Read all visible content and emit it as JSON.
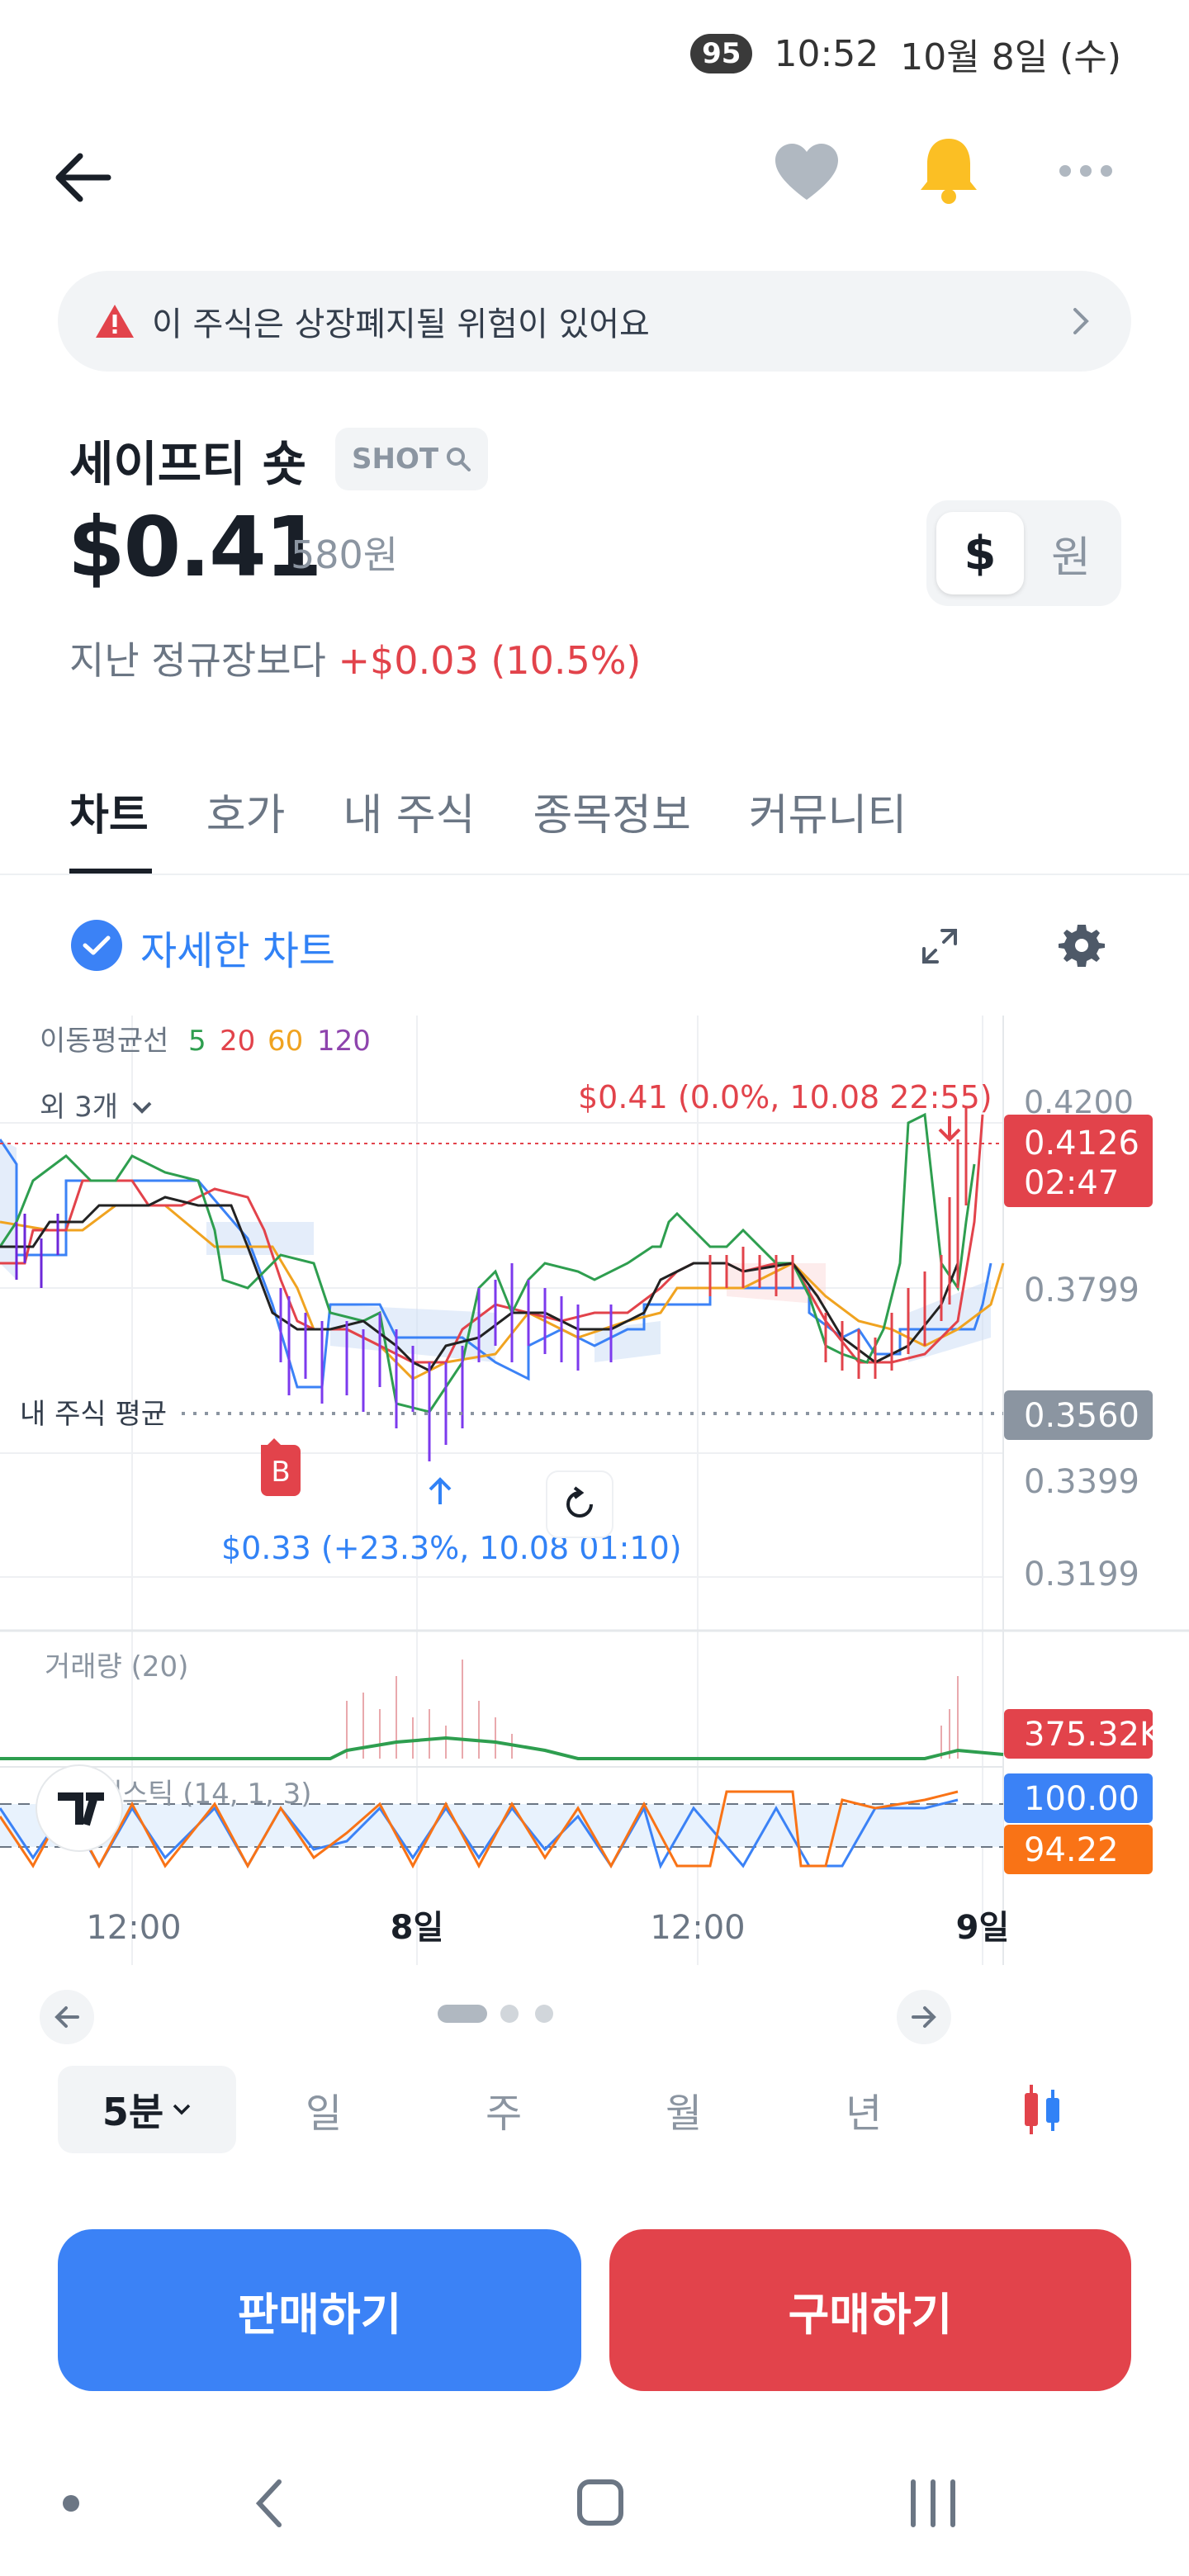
{
  "status_bar": {
    "battery": "95",
    "time": "10:52",
    "date": "10월 8일 (수)"
  },
  "warning": {
    "text": "이 주식은 상장폐지될 위험이 있어요"
  },
  "stock": {
    "name": "세이프티 숏",
    "ticker": "SHOT",
    "price": "$0.41",
    "price_krw": "580원",
    "change_prefix": "지난 정규장보다",
    "change_value": "+$0.03 (10.5%)",
    "currency_on": "$",
    "currency_off": "원"
  },
  "tabs": [
    "차트",
    "호가",
    "내 주식",
    "종목정보",
    "커뮤니티"
  ],
  "chart_toolbar": {
    "detail_label": "자세한 차트"
  },
  "chart": {
    "ma_label": "이동평균선",
    "ma_periods": [
      "5",
      "20",
      "60",
      "120"
    ],
    "more_label": "외 3개",
    "high_annotation": "$0.41 (0.0%, 10.08 22:55)",
    "low_annotation": "$0.33 (+23.3%, 10.08 01:10)",
    "my_avg_label": "내 주식 평균",
    "current_price": "0.4126",
    "countdown": "02:47",
    "avg_price": "0.3560",
    "y_ticks": [
      "0.4200",
      "0.3799",
      "0.3399",
      "0.3199"
    ],
    "volume_label": "거래량 (20)",
    "volume_value": "375.32K",
    "stoch_label": "스토캐스틱 (14, 1, 3)",
    "stoch_k": "100.00",
    "stoch_d": "94.22",
    "x_ticks": [
      "12:00",
      "8일",
      "12:00",
      "9일"
    ],
    "buy_marker": "B",
    "colors": {
      "ma5": "#2e9e4f",
      "ma20": "#e2434b",
      "ma60": "#f0a320",
      "ma120": "#8e44ad"
    }
  },
  "periods": {
    "selected": "5분",
    "options": [
      "일",
      "주",
      "월",
      "년"
    ]
  },
  "actions": {
    "sell": "판매하기",
    "buy": "구매하기"
  }
}
